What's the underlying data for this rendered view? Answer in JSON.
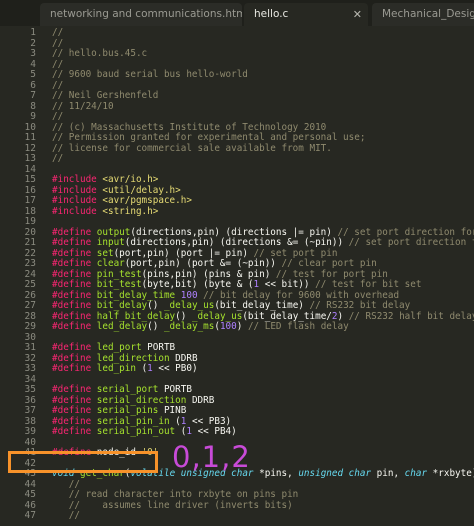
{
  "tabs": [
    {
      "label": "networking and communications.html",
      "active": false
    },
    {
      "label": "hello.c",
      "active": true
    },
    {
      "label": "Mechanical_Design.h",
      "active": false
    }
  ],
  "lines": [
    {
      "n": "1",
      "segs": [
        {
          "t": "//",
          "c": "com"
        }
      ]
    },
    {
      "n": "2",
      "segs": [
        {
          "t": "//",
          "c": "com"
        }
      ]
    },
    {
      "n": "3",
      "segs": [
        {
          "t": "// hello.bus.45.c",
          "c": "com"
        }
      ]
    },
    {
      "n": "4",
      "segs": [
        {
          "t": "//",
          "c": "com"
        }
      ]
    },
    {
      "n": "5",
      "segs": [
        {
          "t": "// 9600 baud serial bus hello-world",
          "c": "com"
        }
      ]
    },
    {
      "n": "6",
      "segs": [
        {
          "t": "//",
          "c": "com"
        }
      ]
    },
    {
      "n": "7",
      "segs": [
        {
          "t": "// Neil Gershenfeld",
          "c": "com"
        }
      ]
    },
    {
      "n": "8",
      "segs": [
        {
          "t": "// 11/24/10",
          "c": "com"
        }
      ]
    },
    {
      "n": "9",
      "segs": [
        {
          "t": "//",
          "c": "com"
        }
      ]
    },
    {
      "n": "10",
      "segs": [
        {
          "t": "// (c) Massachusetts Institute of Technology 2010",
          "c": "com"
        }
      ]
    },
    {
      "n": "11",
      "segs": [
        {
          "t": "// Permission granted for experimental and personal use;",
          "c": "com"
        }
      ]
    },
    {
      "n": "12",
      "segs": [
        {
          "t": "// license for commercial sale available from MIT.",
          "c": "com"
        }
      ]
    },
    {
      "n": "13",
      "segs": [
        {
          "t": "//",
          "c": "com"
        }
      ]
    },
    {
      "n": "14",
      "segs": []
    },
    {
      "n": "15",
      "segs": [
        {
          "t": "#include ",
          "c": "pp"
        },
        {
          "t": "<avr/io.h>",
          "c": "inc"
        }
      ]
    },
    {
      "n": "16",
      "segs": [
        {
          "t": "#include ",
          "c": "pp"
        },
        {
          "t": "<util/delay.h>",
          "c": "inc"
        }
      ]
    },
    {
      "n": "17",
      "segs": [
        {
          "t": "#include ",
          "c": "pp"
        },
        {
          "t": "<avr/pgmspace.h>",
          "c": "inc"
        }
      ]
    },
    {
      "n": "18",
      "segs": [
        {
          "t": "#include ",
          "c": "pp"
        },
        {
          "t": "<string.h>",
          "c": "inc"
        }
      ]
    },
    {
      "n": "19",
      "segs": []
    },
    {
      "n": "20",
      "segs": [
        {
          "t": "#define ",
          "c": "pp"
        },
        {
          "t": "output",
          "c": "fn"
        },
        {
          "t": "(directions,pin) (directions |= pin) ",
          "c": ""
        },
        {
          "t": "// set port direction for output",
          "c": "com"
        }
      ]
    },
    {
      "n": "21",
      "segs": [
        {
          "t": "#define ",
          "c": "pp"
        },
        {
          "t": "input",
          "c": "fn"
        },
        {
          "t": "(directions,pin) (directions &= (~pin)) ",
          "c": ""
        },
        {
          "t": "// set port direction for input",
          "c": "com"
        }
      ]
    },
    {
      "n": "22",
      "segs": [
        {
          "t": "#define ",
          "c": "pp"
        },
        {
          "t": "set",
          "c": "fn"
        },
        {
          "t": "(port,pin) (port |= pin) ",
          "c": ""
        },
        {
          "t": "// set port pin",
          "c": "com"
        }
      ]
    },
    {
      "n": "23",
      "segs": [
        {
          "t": "#define ",
          "c": "pp"
        },
        {
          "t": "clear",
          "c": "fn"
        },
        {
          "t": "(port,pin) (port &= (~pin)) ",
          "c": ""
        },
        {
          "t": "// clear port pin",
          "c": "com"
        }
      ]
    },
    {
      "n": "24",
      "segs": [
        {
          "t": "#define ",
          "c": "pp"
        },
        {
          "t": "pin_test",
          "c": "fn"
        },
        {
          "t": "(pins,pin) (pins & pin) ",
          "c": ""
        },
        {
          "t": "// test for port pin",
          "c": "com"
        }
      ]
    },
    {
      "n": "25",
      "segs": [
        {
          "t": "#define ",
          "c": "pp"
        },
        {
          "t": "bit_test",
          "c": "fn"
        },
        {
          "t": "(byte,bit) (byte & (",
          "c": ""
        },
        {
          "t": "1",
          "c": "num"
        },
        {
          "t": " << bit)) ",
          "c": ""
        },
        {
          "t": "// test for bit set",
          "c": "com"
        }
      ]
    },
    {
      "n": "26",
      "segs": [
        {
          "t": "#define ",
          "c": "pp"
        },
        {
          "t": "bit_delay_time ",
          "c": "fn"
        },
        {
          "t": "100",
          "c": "num"
        },
        {
          "t": " ",
          "c": ""
        },
        {
          "t": "// bit delay for 9600 with overhead",
          "c": "com"
        }
      ]
    },
    {
      "n": "27",
      "segs": [
        {
          "t": "#define ",
          "c": "pp"
        },
        {
          "t": "bit_delay",
          "c": "fn"
        },
        {
          "t": "() ",
          "c": ""
        },
        {
          "t": "_delay_us",
          "c": "fn"
        },
        {
          "t": "(bit_delay_time) ",
          "c": ""
        },
        {
          "t": "// RS232 bit delay",
          "c": "com"
        }
      ]
    },
    {
      "n": "28",
      "segs": [
        {
          "t": "#define ",
          "c": "pp"
        },
        {
          "t": "half_bit_delay",
          "c": "fn"
        },
        {
          "t": "() ",
          "c": ""
        },
        {
          "t": "_delay_us",
          "c": "fn"
        },
        {
          "t": "(bit_delay_time/",
          "c": ""
        },
        {
          "t": "2",
          "c": "num"
        },
        {
          "t": ") ",
          "c": ""
        },
        {
          "t": "// RS232 half bit delay",
          "c": "com"
        }
      ]
    },
    {
      "n": "29",
      "segs": [
        {
          "t": "#define ",
          "c": "pp"
        },
        {
          "t": "led_delay",
          "c": "fn"
        },
        {
          "t": "() ",
          "c": ""
        },
        {
          "t": "_delay_ms",
          "c": "fn"
        },
        {
          "t": "(",
          "c": ""
        },
        {
          "t": "100",
          "c": "num"
        },
        {
          "t": ") ",
          "c": ""
        },
        {
          "t": "// LED flash delay",
          "c": "com"
        }
      ]
    },
    {
      "n": "30",
      "segs": []
    },
    {
      "n": "31",
      "segs": [
        {
          "t": "#define ",
          "c": "pp"
        },
        {
          "t": "led_port ",
          "c": "fn"
        },
        {
          "t": "PORTB",
          "c": ""
        }
      ]
    },
    {
      "n": "32",
      "segs": [
        {
          "t": "#define ",
          "c": "pp"
        },
        {
          "t": "led_direction ",
          "c": "fn"
        },
        {
          "t": "DDRB",
          "c": ""
        }
      ]
    },
    {
      "n": "33",
      "segs": [
        {
          "t": "#define ",
          "c": "pp"
        },
        {
          "t": "led_pin ",
          "c": "fn"
        },
        {
          "t": "(",
          "c": ""
        },
        {
          "t": "1",
          "c": "num"
        },
        {
          "t": " << PB0)",
          "c": ""
        }
      ]
    },
    {
      "n": "34",
      "segs": []
    },
    {
      "n": "35",
      "segs": [
        {
          "t": "#define ",
          "c": "pp"
        },
        {
          "t": "serial_port ",
          "c": "fn"
        },
        {
          "t": "PORTB",
          "c": ""
        }
      ]
    },
    {
      "n": "36",
      "segs": [
        {
          "t": "#define ",
          "c": "pp"
        },
        {
          "t": "serial_direction ",
          "c": "fn"
        },
        {
          "t": "DDRB",
          "c": ""
        }
      ]
    },
    {
      "n": "37",
      "segs": [
        {
          "t": "#define ",
          "c": "pp"
        },
        {
          "t": "serial_pins ",
          "c": "fn"
        },
        {
          "t": "PINB",
          "c": ""
        }
      ]
    },
    {
      "n": "38",
      "segs": [
        {
          "t": "#define ",
          "c": "pp"
        },
        {
          "t": "serial_pin_in ",
          "c": "fn"
        },
        {
          "t": "(",
          "c": ""
        },
        {
          "t": "1",
          "c": "num"
        },
        {
          "t": " << PB3)",
          "c": ""
        }
      ]
    },
    {
      "n": "39",
      "segs": [
        {
          "t": "#define ",
          "c": "pp"
        },
        {
          "t": "serial_pin_out ",
          "c": "fn"
        },
        {
          "t": "(",
          "c": ""
        },
        {
          "t": "1",
          "c": "num"
        },
        {
          "t": " << PB4)",
          "c": ""
        }
      ]
    },
    {
      "n": "40",
      "segs": []
    },
    {
      "n": "41",
      "segs": [
        {
          "t": "#define ",
          "c": "pp"
        },
        {
          "t": "node_id ",
          "c": ""
        },
        {
          "t": "'0'",
          "c": "str"
        }
      ]
    },
    {
      "n": "42",
      "segs": []
    },
    {
      "n": "43",
      "segs": [
        {
          "t": "void ",
          "c": "kw"
        },
        {
          "t": "get_char",
          "c": "fn"
        },
        {
          "t": "(",
          "c": ""
        },
        {
          "t": "volatile unsigned char",
          "c": "kw"
        },
        {
          "t": " *pins, ",
          "c": ""
        },
        {
          "t": "unsigned char",
          "c": "kw"
        },
        {
          "t": " pin, ",
          "c": ""
        },
        {
          "t": "char",
          "c": "kw"
        },
        {
          "t": " *rxbyte) {",
          "c": ""
        }
      ]
    },
    {
      "n": "44",
      "segs": [
        {
          "t": "   //",
          "c": "com"
        }
      ]
    },
    {
      "n": "45",
      "segs": [
        {
          "t": "   // read character into rxbyte on pins pin",
          "c": "com"
        }
      ]
    },
    {
      "n": "46",
      "segs": [
        {
          "t": "   //    assumes line driver (inverts bits)",
          "c": "com"
        }
      ]
    },
    {
      "n": "47",
      "segs": [
        {
          "t": "   //",
          "c": "com"
        }
      ]
    }
  ],
  "annotation": {
    "text": "0,1,2",
    "color": "#c84bd8",
    "box_color": "#f7922a"
  }
}
